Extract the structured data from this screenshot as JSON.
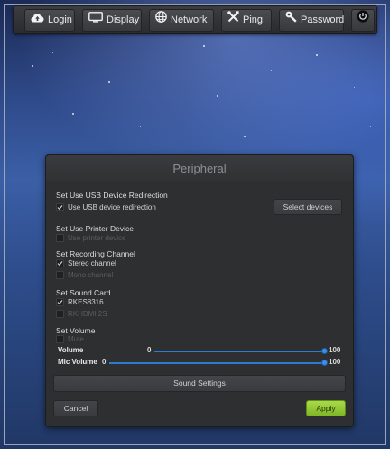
{
  "toolbar": {
    "login": "Login",
    "display": "Display",
    "network": "Network",
    "ping": "Ping",
    "password": "Password"
  },
  "dialog": {
    "title": "Peripheral",
    "usb": {
      "section": "Set Use USB Device Redirection",
      "option": "Use USB device redirection",
      "option_checked": true,
      "button": "Select devices"
    },
    "printer": {
      "section": "Set Use Printer Device",
      "option": "Use printer device",
      "option_checked": false
    },
    "recording": {
      "section": "Set Recording Channel",
      "options": [
        {
          "label": "Stereo channel",
          "checked": true
        },
        {
          "label": "Mono channel",
          "checked": false
        }
      ]
    },
    "sound_card": {
      "section": "Set Sound Card",
      "options": [
        {
          "label": "RKES8316",
          "checked": true
        },
        {
          "label": "RKHDMII2S",
          "checked": false
        }
      ]
    },
    "volume": {
      "section": "Set Volume",
      "mute": {
        "label": "Mute",
        "checked": false
      },
      "volume": {
        "label": "Volume",
        "min": "0",
        "max": "100",
        "value": 100
      },
      "mic_volume": {
        "label": "Mic Volume",
        "min": "0",
        "max": "100",
        "value": 100
      }
    },
    "sound_settings": "Sound Settings",
    "cancel": "Cancel",
    "apply": "Apply"
  },
  "colors": {
    "accent_slider": "#2e7bd1",
    "apply_button": "#8fc734",
    "dialog_bg": "#2e2f31"
  }
}
